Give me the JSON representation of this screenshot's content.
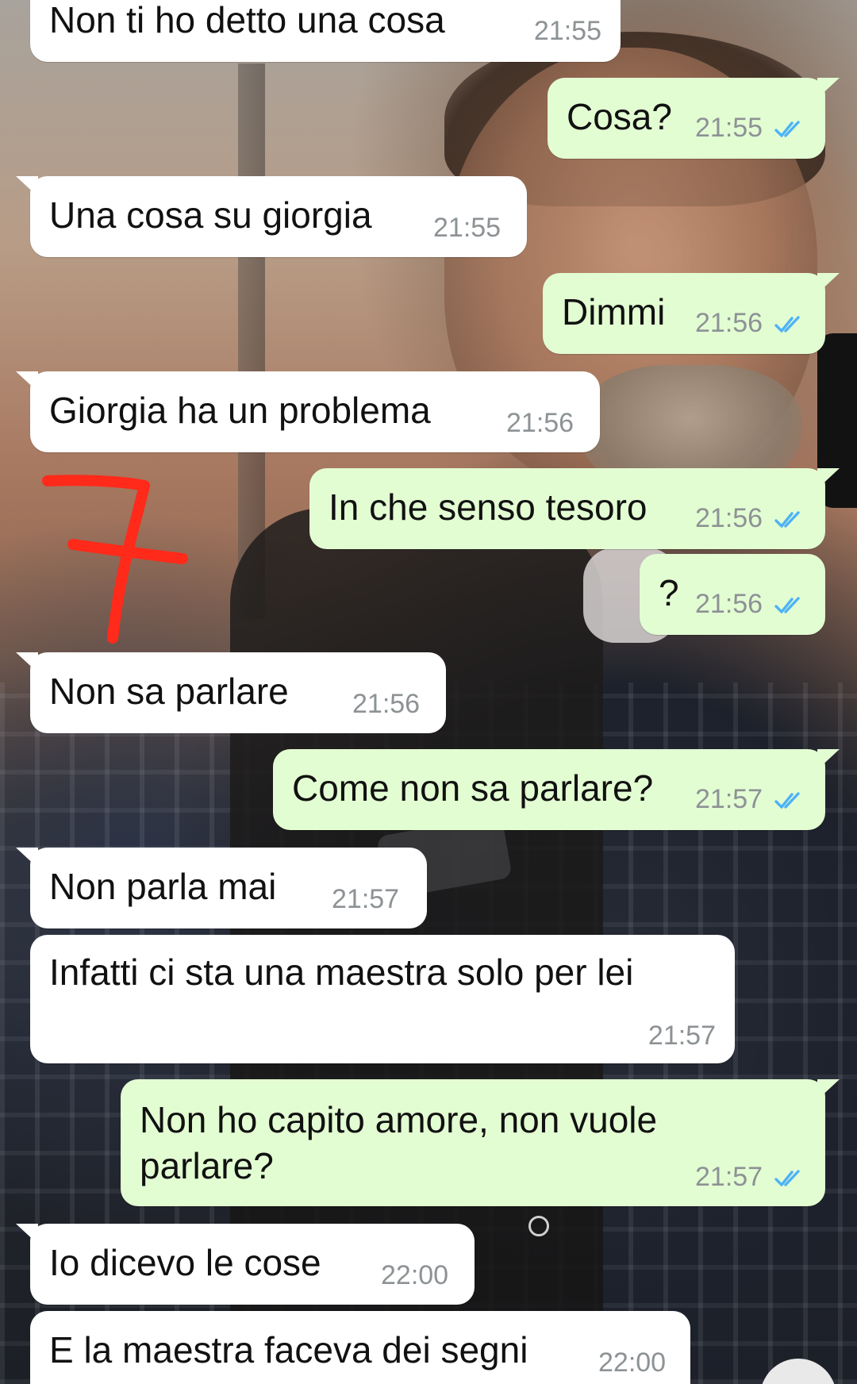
{
  "colors": {
    "incoming_bubble": "#ffffff",
    "outgoing_bubble": "#e3fdd3",
    "timestamp": "#8d9295",
    "read_ticks": "#4fb3f6",
    "annotation": "#ff2a1a"
  },
  "annotation": {
    "mark": "red-hand-drawn-7"
  },
  "messages": [
    {
      "dir": "in",
      "text": "Non ti ho detto una cosa",
      "time": "21:55"
    },
    {
      "dir": "out",
      "text": "Cosa?",
      "time": "21:55",
      "status": "read-double-check-icon"
    },
    {
      "dir": "in",
      "text": "Una cosa su giorgia",
      "time": "21:55"
    },
    {
      "dir": "out",
      "text": "Dimmi",
      "time": "21:56",
      "status": "read-double-check-icon"
    },
    {
      "dir": "in",
      "text": "Giorgia ha un problema",
      "time": "21:56"
    },
    {
      "dir": "out",
      "text": "In che senso tesoro",
      "time": "21:56",
      "status": "read-double-check-icon"
    },
    {
      "dir": "out",
      "text": "?",
      "time": "21:56",
      "status": "read-double-check-icon"
    },
    {
      "dir": "in",
      "text": "Non sa parlare",
      "time": "21:56"
    },
    {
      "dir": "out",
      "text": "Come non sa parlare?",
      "time": "21:57",
      "status": "read-double-check-icon"
    },
    {
      "dir": "in",
      "text": "Non parla mai",
      "time": "21:57"
    },
    {
      "dir": "in",
      "text": "Infatti ci sta una maestra solo per lei",
      "time": "21:57"
    },
    {
      "dir": "out",
      "text": "Non ho capito amore, non vuole",
      "text2": "parlare?",
      "time": "21:57",
      "status": "read-double-check-icon"
    },
    {
      "dir": "in",
      "text": "Io dicevo le cose",
      "time": "22:00"
    },
    {
      "dir": "in",
      "text": "E la maestra faceva dei segni",
      "time": "22:00"
    }
  ],
  "scroll_button": {
    "icon": "chevron-down-icon"
  }
}
